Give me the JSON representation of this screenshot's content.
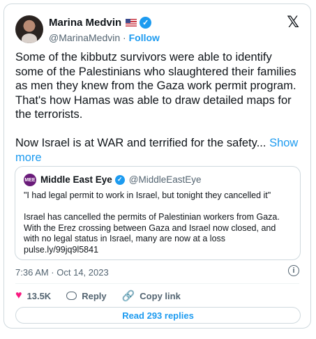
{
  "author": {
    "name": "Marina Medvin",
    "handle": "@MarinaMedvin",
    "separator": "·",
    "follow_label": "Follow",
    "flag_icon": "us-flag-icon",
    "verified_icon": "verified-badge-icon"
  },
  "tweet": {
    "text": "Some of the kibbutz survivors were able to identify some of the Palestinians who slaughtered their families as men they knew from the Gaza work permit program. That's how Hamas was able to draw detailed maps for the terrorists.\n\nNow Israel is at WAR and terrified for the safety... ",
    "show_more": "Show more"
  },
  "quote": {
    "avatar_text": "MEE",
    "name": "Middle East Eye",
    "handle": "@MiddleEastEye",
    "text": "\"I had legal permit to work in Israel, but tonight they cancelled it\"\n\nIsrael has cancelled the permits of Palestinian workers from Gaza. With the Erez crossing between Gaza and Israel now closed, and with no legal status in Israel, many are now at a loss\npulse.ly/99jq9l5841"
  },
  "meta": {
    "timestamp": "7:36 AM · Oct 14, 2023"
  },
  "actions": {
    "likes": "13.5K",
    "reply_label": "Reply",
    "copy_link_label": "Copy link"
  },
  "read_replies_label": "Read 293 replies",
  "colors": {
    "accent": "#1d9bf0",
    "like": "#f91880",
    "muted": "#536471"
  }
}
